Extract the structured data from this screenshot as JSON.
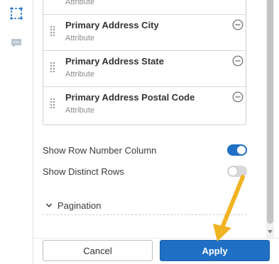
{
  "rail": {
    "icons": [
      "select-region-icon",
      "comment-icon"
    ]
  },
  "fields": [
    {
      "name": "",
      "type": "Attribute"
    },
    {
      "name": "Primary Address City",
      "type": "Attribute"
    },
    {
      "name": "Primary Address State",
      "type": "Attribute"
    },
    {
      "name": "Primary Address Postal Code",
      "type": "Attribute"
    }
  ],
  "options": {
    "row_number": {
      "label": "Show Row Number Column",
      "enabled": true
    },
    "distinct_rows": {
      "label": "Show Distinct Rows",
      "enabled": false
    }
  },
  "pagination": {
    "label": "Pagination",
    "expanded": false
  },
  "footer": {
    "cancel_label": "Cancel",
    "apply_label": "Apply"
  },
  "colors": {
    "accent": "#1f6fc5",
    "annotation_arrow": "#f0b323"
  }
}
